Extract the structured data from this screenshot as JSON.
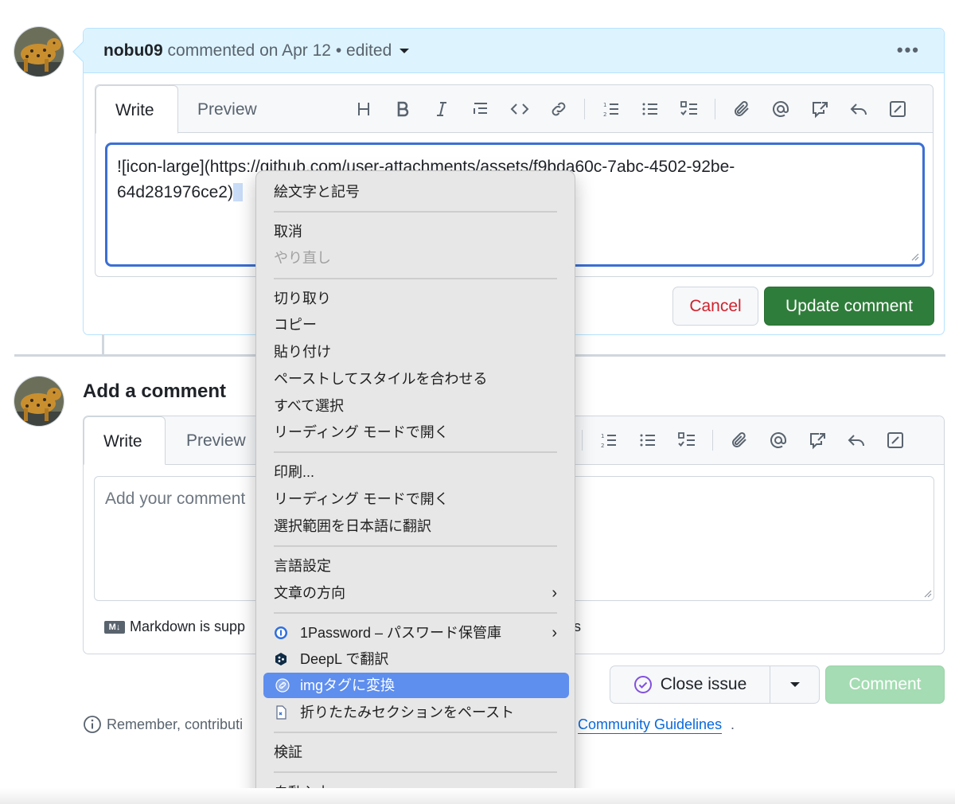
{
  "edit_comment": {
    "author": "nobu09",
    "action": "commented on Apr 12",
    "separator": "•",
    "edited": "edited",
    "more_icon": "•••",
    "tabs": [
      "Write",
      "Preview"
    ],
    "textarea_line1": "![icon-large](https://github.com/user-attachments/assets/f9bda60c-7abc-4502-92be-",
    "textarea_line2": "64d281976ce2)",
    "cancel_label": "Cancel",
    "update_label": "Update comment"
  },
  "add_comment": {
    "title": "Add a comment",
    "tabs": [
      "Write",
      "Preview"
    ],
    "placeholder": "Add your comment",
    "markdown_note": "Markdown is supp",
    "markdown_badge": "M↓",
    "markdown_tail": "s",
    "close_issue_label": "Close issue",
    "comment_label": "Comment"
  },
  "footer": {
    "remember": "Remember, contributi",
    "guidelines": "Community Guidelines",
    "dot": "."
  },
  "context_menu": {
    "emoji": "絵文字と記号",
    "undo": "取消",
    "redo": "やり直し",
    "cut": "切り取り",
    "copy": "コピー",
    "paste": "貼り付け",
    "paste_match": "ペーストしてスタイルを合わせる",
    "select_all": "すべて選択",
    "reading_mode_1": "リーディング モードで開く",
    "print": "印刷...",
    "reading_mode_2": "リーディング モードで開く",
    "translate": "選択範囲を日本語に翻訳",
    "language": "言語設定",
    "direction": "文章の方向",
    "onepassword": "1Password – パスワード保管庫",
    "deepl": "DeepL で翻訳",
    "img_tag": "imgタグに変換",
    "paste_folding": "折りたたみセクションをペースト",
    "inspect": "検証",
    "autofill": "自動入力",
    "chevron": "›"
  },
  "colors": {
    "header_bg": "#ddf4ff",
    "update_button": "#2f7d3b",
    "cancel_text": "#cf222e",
    "menu_highlight": "#5e8eee",
    "comment_disabled": "#a5dcb3",
    "link": "#0969da"
  }
}
